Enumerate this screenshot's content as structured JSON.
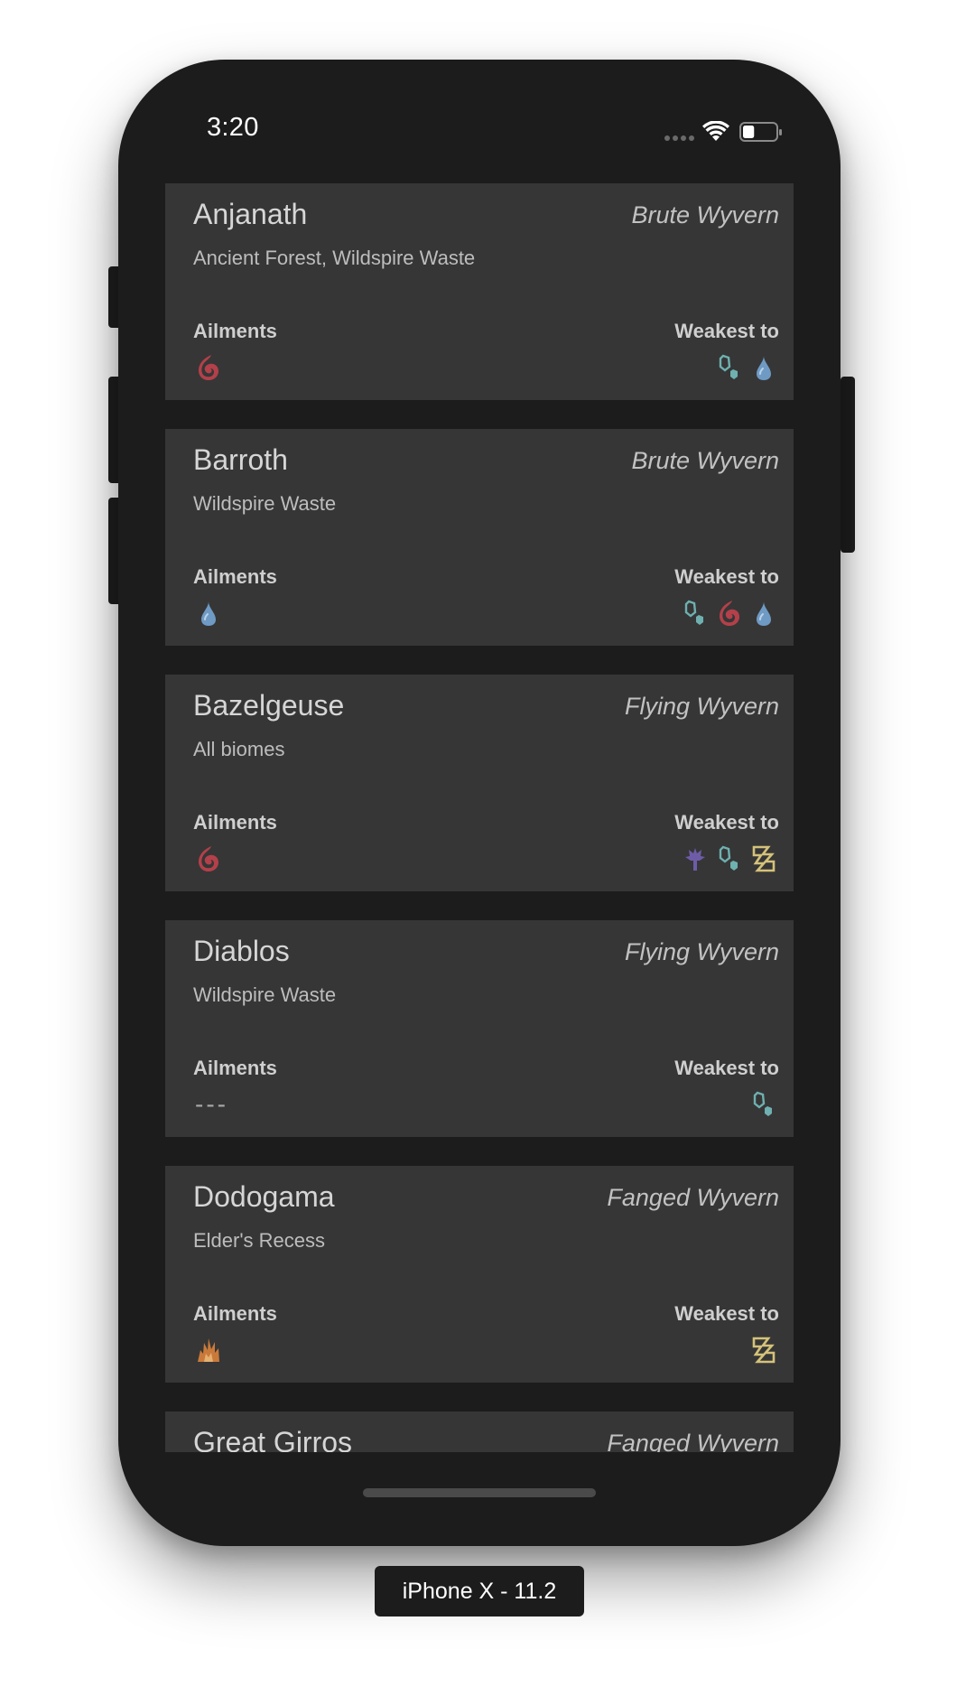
{
  "status_bar": {
    "time": "3:20",
    "signal_icon": "cellular-dots-icon",
    "wifi_icon": "wifi-icon",
    "battery_icon": "battery-icon",
    "battery_level_percent": 35
  },
  "monsters": [
    {
      "name": "Anjanath",
      "type": "Brute Wyvern",
      "locations": "Ancient Forest, Wildspire Waste",
      "ailments_label": "Ailments",
      "weakness_label": "Weakest to",
      "ailments": [
        "fireblight"
      ],
      "weaknesses": [
        "ice",
        "water"
      ]
    },
    {
      "name": "Barroth",
      "type": "Brute Wyvern",
      "locations": "Wildspire Waste",
      "ailments_label": "Ailments",
      "weakness_label": "Weakest to",
      "ailments": [
        "water"
      ],
      "weaknesses": [
        "ice",
        "fire",
        "water"
      ]
    },
    {
      "name": "Bazelgeuse",
      "type": "Flying Wyvern",
      "locations": "All biomes",
      "ailments_label": "Ailments",
      "weakness_label": "Weakest to",
      "ailments": [
        "fireblight"
      ],
      "weaknesses": [
        "dragon",
        "ice",
        "thunder"
      ]
    },
    {
      "name": "Diablos",
      "type": "Flying Wyvern",
      "locations": "Wildspire Waste",
      "ailments_label": "Ailments",
      "weakness_label": "Weakest to",
      "ailments": [],
      "ailments_none": "---",
      "weaknesses": [
        "ice"
      ]
    },
    {
      "name": "Dodogama",
      "type": "Fanged Wyvern",
      "locations": "Elder's Recess",
      "ailments_label": "Ailments",
      "weakness_label": "Weakest to",
      "ailments": [
        "blast"
      ],
      "weaknesses": [
        "thunder"
      ]
    },
    {
      "name": "Great Girros",
      "type": "Fanged Wyvern",
      "locations": "",
      "ailments_label": "",
      "weakness_label": "",
      "ailments": [],
      "weaknesses": []
    }
  ],
  "element_colors": {
    "fire": "#b3404a",
    "water": "#6f9ac4",
    "ice": "#6fb0b0",
    "thunder": "#d4c27a",
    "dragon": "#6e5ca8",
    "blast": "#c97a3a"
  },
  "device_label": "iPhone X - 11.2"
}
